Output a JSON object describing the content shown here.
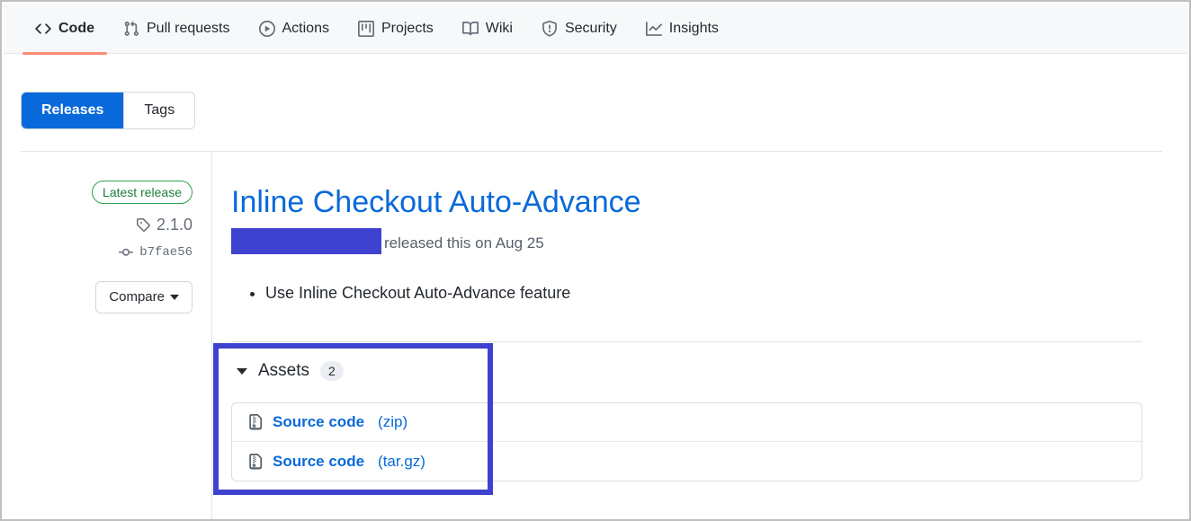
{
  "repo_nav": {
    "items": [
      {
        "label": "Code",
        "icon": "code-icon",
        "active": true
      },
      {
        "label": "Pull requests",
        "icon": "git-pull-request-icon",
        "active": false
      },
      {
        "label": "Actions",
        "icon": "play-circle-icon",
        "active": false
      },
      {
        "label": "Projects",
        "icon": "project-board-icon",
        "active": false
      },
      {
        "label": "Wiki",
        "icon": "book-icon",
        "active": false
      },
      {
        "label": "Security",
        "icon": "shield-icon",
        "active": false
      },
      {
        "label": "Insights",
        "icon": "graph-line-icon",
        "active": false
      }
    ],
    "active_underline_color": "#fd8c73"
  },
  "segmented": {
    "releases_label": "Releases",
    "tags_label": "Tags",
    "selected": "Releases",
    "selected_color": "#0969da"
  },
  "sidebar": {
    "latest_badge": "Latest release",
    "tag_name": "2.1.0",
    "tag_icon": "tag-icon",
    "commit_sha": "b7fae56",
    "commit_icon": "git-commit-icon",
    "compare_label": "Compare",
    "compare_caret_icon": "caret-down-icon",
    "badge_border_color": "#2da44e"
  },
  "release": {
    "title": "Inline Checkout Auto-Advance",
    "title_color": "#0969da",
    "byline": "released this on Aug 25",
    "author_redacted": true,
    "redaction_color": "#3f42cf",
    "notes": [
      "Use Inline Checkout Auto-Advance feature"
    ]
  },
  "assets": {
    "header_label": "Assets",
    "count": "2",
    "collapse_icon": "triangle-down-icon",
    "items": [
      {
        "name": "Source code",
        "ext": "(zip)",
        "icon": "file-zip-icon"
      },
      {
        "name": "Source code",
        "ext": "(tar.gz)",
        "icon": "file-zip-icon"
      }
    ]
  },
  "annotation": {
    "color": "#3f42cf",
    "target": "assets-section"
  }
}
